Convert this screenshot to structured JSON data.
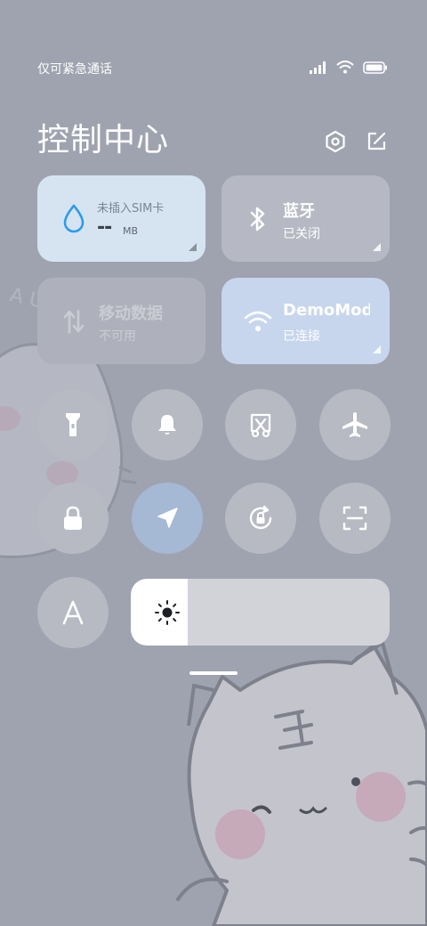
{
  "status_bar": {
    "carrier_text": "仅可紧急通话",
    "icons": [
      "signal-icon",
      "wifi-icon",
      "battery-icon"
    ]
  },
  "header": {
    "title": "控制中心",
    "buttons": [
      "settings-icon",
      "edit-icon"
    ]
  },
  "tiles": {
    "mobile_data_usage": {
      "label": "未插入SIM卡",
      "value": "--",
      "unit": "MB",
      "icon": "water-drop-icon"
    },
    "bluetooth": {
      "title": "蓝牙",
      "subtitle": "已关闭",
      "icon": "bluetooth-icon"
    },
    "mobile_data": {
      "title": "移动数据",
      "subtitle": "不可用",
      "icon": "data-arrows-icon",
      "enabled": false
    },
    "wifi": {
      "title": "DemoMode",
      "subtitle": "已连接",
      "icon": "wifi-icon",
      "active": true
    }
  },
  "toggles": [
    {
      "name": "flashlight",
      "icon": "flashlight-icon",
      "active": false
    },
    {
      "name": "ringer",
      "icon": "bell-icon",
      "active": false
    },
    {
      "name": "screenshot",
      "icon": "screenshot-scissors-icon",
      "active": false
    },
    {
      "name": "airplane-mode",
      "icon": "airplane-icon",
      "active": false
    },
    {
      "name": "lock-screen",
      "icon": "lock-icon",
      "active": false
    },
    {
      "name": "location",
      "icon": "location-arrow-icon",
      "active": true
    },
    {
      "name": "auto-rotate",
      "icon": "rotation-lock-icon",
      "active": false
    },
    {
      "name": "scanner",
      "icon": "scan-icon",
      "active": false
    },
    {
      "name": "font-size",
      "icon": "font-a-icon",
      "active": false
    }
  ],
  "brightness": {
    "level_percent": 22,
    "icon": "sun-icon"
  },
  "colors": {
    "background": "#9fa3b0",
    "data_tile": "#d6e4f2",
    "wifi_tile": "#c7d6ec",
    "active_toggle": "#a5b8d4",
    "water_drop": "#2f9be8"
  }
}
